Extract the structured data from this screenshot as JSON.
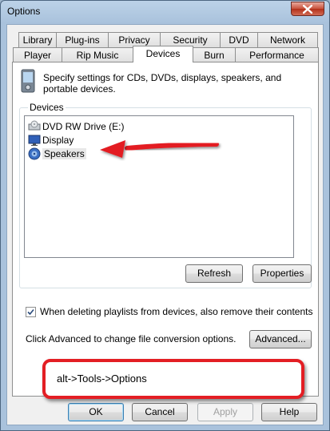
{
  "window": {
    "title": "Options"
  },
  "tabs_row1": [
    "Library",
    "Plug-ins",
    "Privacy",
    "Security",
    "DVD",
    "Network"
  ],
  "tabs_row2": [
    "Player",
    "Rip Music",
    "Devices",
    "Burn",
    "Performance"
  ],
  "active_tab": "Devices",
  "description": "Specify settings for CDs, DVDs, displays, speakers, and portable devices.",
  "devices": {
    "group_label": "Devices",
    "items": [
      "DVD RW Drive (E:)",
      "Display",
      "Speakers"
    ],
    "selected": "Speakers",
    "refresh_label": "Refresh",
    "properties_label": "Properties"
  },
  "checkbox": {
    "label": "When deleting playlists from devices, also remove their contents",
    "checked": true
  },
  "advanced": {
    "text": "Click Advanced to change file conversion options.",
    "button_label": "Advanced..."
  },
  "annotation": {
    "text": "alt->Tools->Options"
  },
  "dialog_buttons": {
    "ok": "OK",
    "cancel": "Cancel",
    "apply": "Apply",
    "help": "Help"
  },
  "colors": {
    "annotation_red": "#e31e24",
    "title_bar": "#bcd2e8"
  }
}
